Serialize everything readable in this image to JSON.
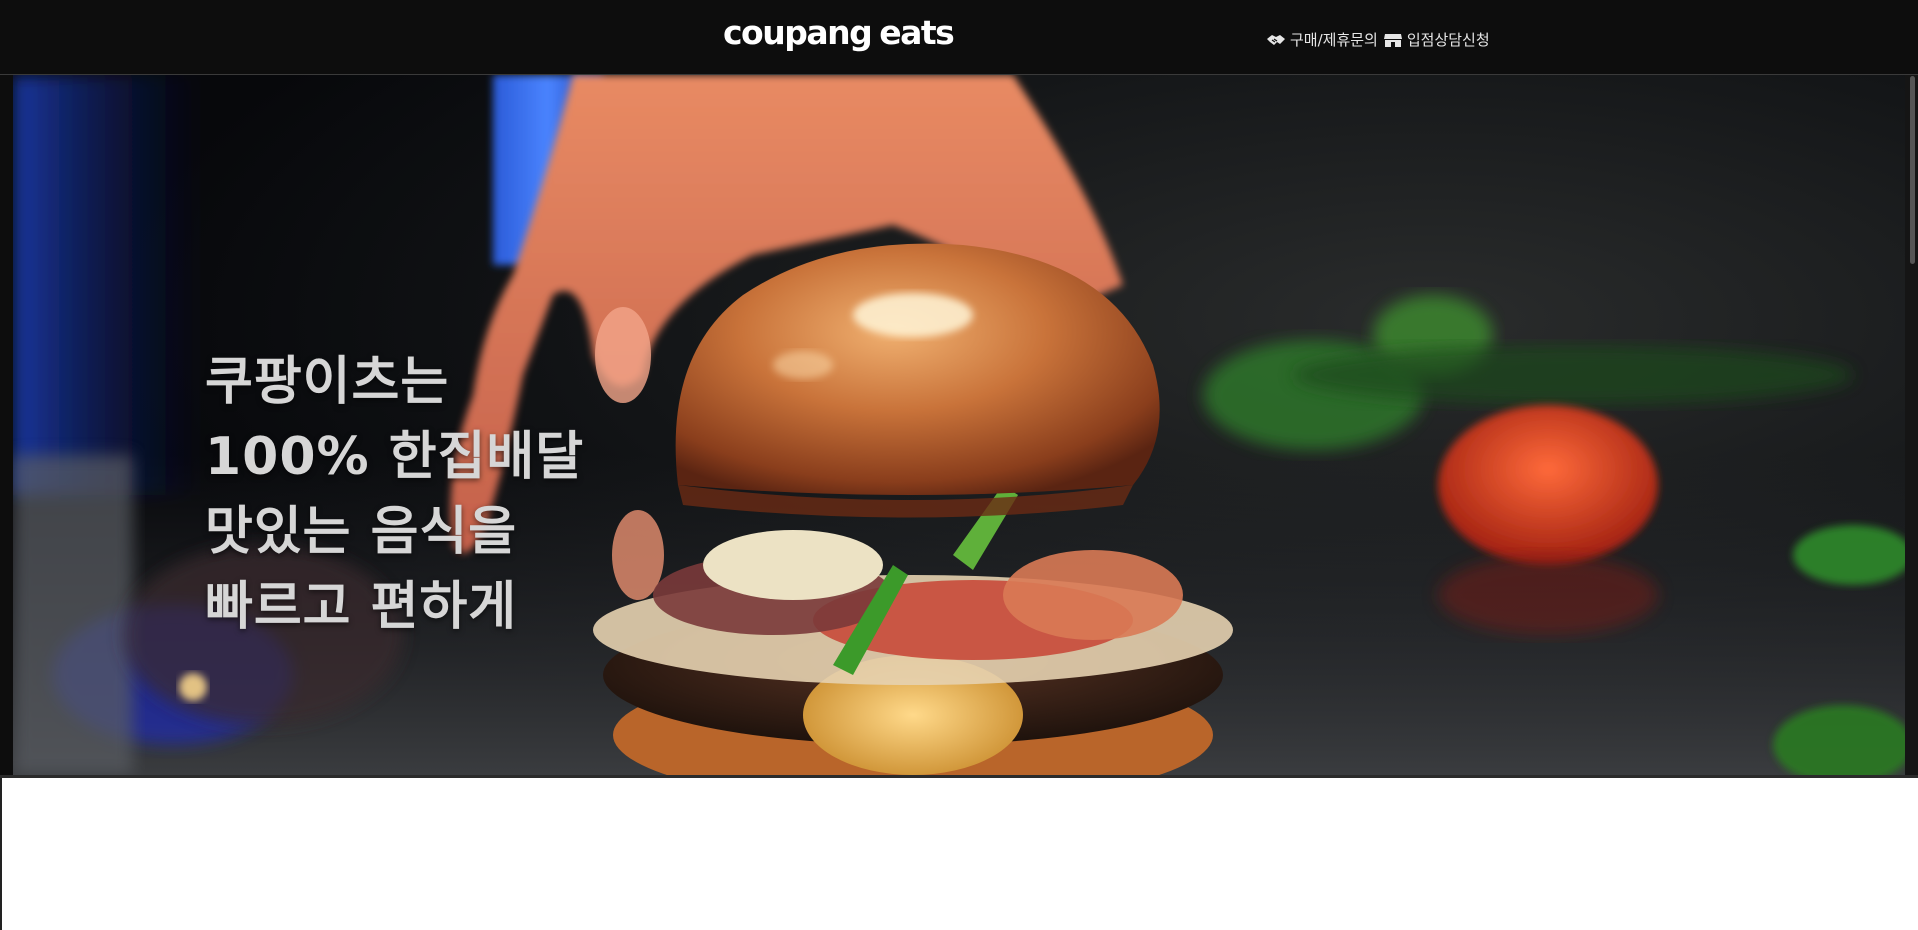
{
  "header": {
    "logo_part1": "coupang",
    "logo_part2": "eats",
    "links": [
      {
        "label": "구매/제휴문의",
        "icon": "handshake-icon"
      },
      {
        "label": "입점상담신청",
        "icon": "store-icon"
      }
    ]
  },
  "hero": {
    "lines": [
      "쿠팡이츠는",
      "100% 한집배달",
      "맛있는 음식을",
      "빠르고 편하게"
    ],
    "image_subject": "burger-photo"
  },
  "colors": {
    "header_bg": "#0d0d0d",
    "hero_text": "#d6d6d6",
    "page_bg": "#ffffff"
  }
}
